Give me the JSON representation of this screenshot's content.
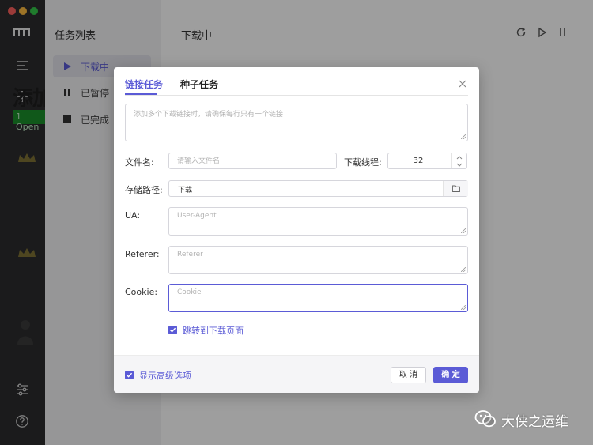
{
  "app": {
    "ghost_heading": "添加",
    "ghost_badge": "1 Open",
    "sidebar": {
      "title": "任务列表",
      "items": [
        {
          "label": "下载中",
          "icon": "play-icon",
          "active": true
        },
        {
          "label": "已暂停",
          "icon": "pause-icon",
          "active": false
        },
        {
          "label": "已完成",
          "icon": "stop-icon",
          "active": false
        }
      ]
    },
    "main": {
      "title": "下载中",
      "actions": [
        "refresh-icon",
        "play-icon",
        "pause-icon"
      ]
    }
  },
  "dialog": {
    "tabs": [
      {
        "label": "链接任务",
        "active": true
      },
      {
        "label": "种子任务",
        "active": false
      }
    ],
    "urls_placeholder": "添加多个下载链接时，请确保每行只有一个链接",
    "filename_label": "文件名:",
    "filename_placeholder": "请输入文件名",
    "threads_label": "下载线程:",
    "threads_value": "32",
    "path_label": "存储路径:",
    "path_value": "下载",
    "ua_label": "UA:",
    "ua_placeholder": "User-Agent",
    "referer_label": "Referer:",
    "referer_placeholder": "Referer",
    "cookie_label": "Cookie:",
    "cookie_placeholder": "Cookie",
    "jump_label": "跳转到下载页面",
    "jump_checked": true,
    "advanced_label": "显示高级选项",
    "advanced_checked": true,
    "cancel_label": "取 消",
    "ok_label": "确 定"
  },
  "watermark": {
    "text": "大侠之运维"
  },
  "colors": {
    "accent": "#5b5bd6",
    "sidebar_dark": "#2c2c2e"
  }
}
